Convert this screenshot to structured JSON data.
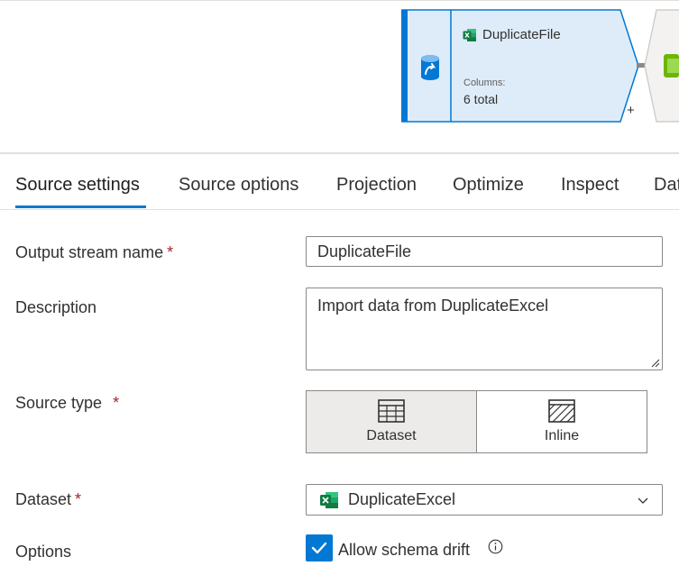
{
  "node": {
    "title": "DuplicateFile",
    "columns_label": "Columns:",
    "columns_value": "6 total",
    "add_symbol": "+",
    "icon": "source-dataset-icon",
    "title_icon": "excel-icon",
    "accent_color": "#0078d4",
    "fill_color": "#deecf9"
  },
  "tabs": [
    {
      "label": "Source settings",
      "active": true
    },
    {
      "label": "Source options"
    },
    {
      "label": "Projection"
    },
    {
      "label": "Optimize"
    },
    {
      "label": "Inspect"
    },
    {
      "label": "Dat"
    }
  ],
  "form": {
    "output_stream_name": {
      "label": "Output stream name",
      "required": "*",
      "value": "DuplicateFile"
    },
    "description": {
      "label": "Description",
      "value": "Import data from DuplicateExcel"
    },
    "source_type": {
      "label": "Source type",
      "required": "*",
      "options": [
        {
          "label": "Dataset",
          "icon": "table-icon",
          "selected": true
        },
        {
          "label": "Inline",
          "icon": "hatched-table-icon",
          "selected": false
        }
      ]
    },
    "dataset": {
      "label": "Dataset",
      "required": "*",
      "value": "DuplicateExcel",
      "icon": "excel-icon"
    },
    "options": {
      "label": "Options",
      "checkbox_label": "Allow schema drift",
      "checked": true
    }
  }
}
